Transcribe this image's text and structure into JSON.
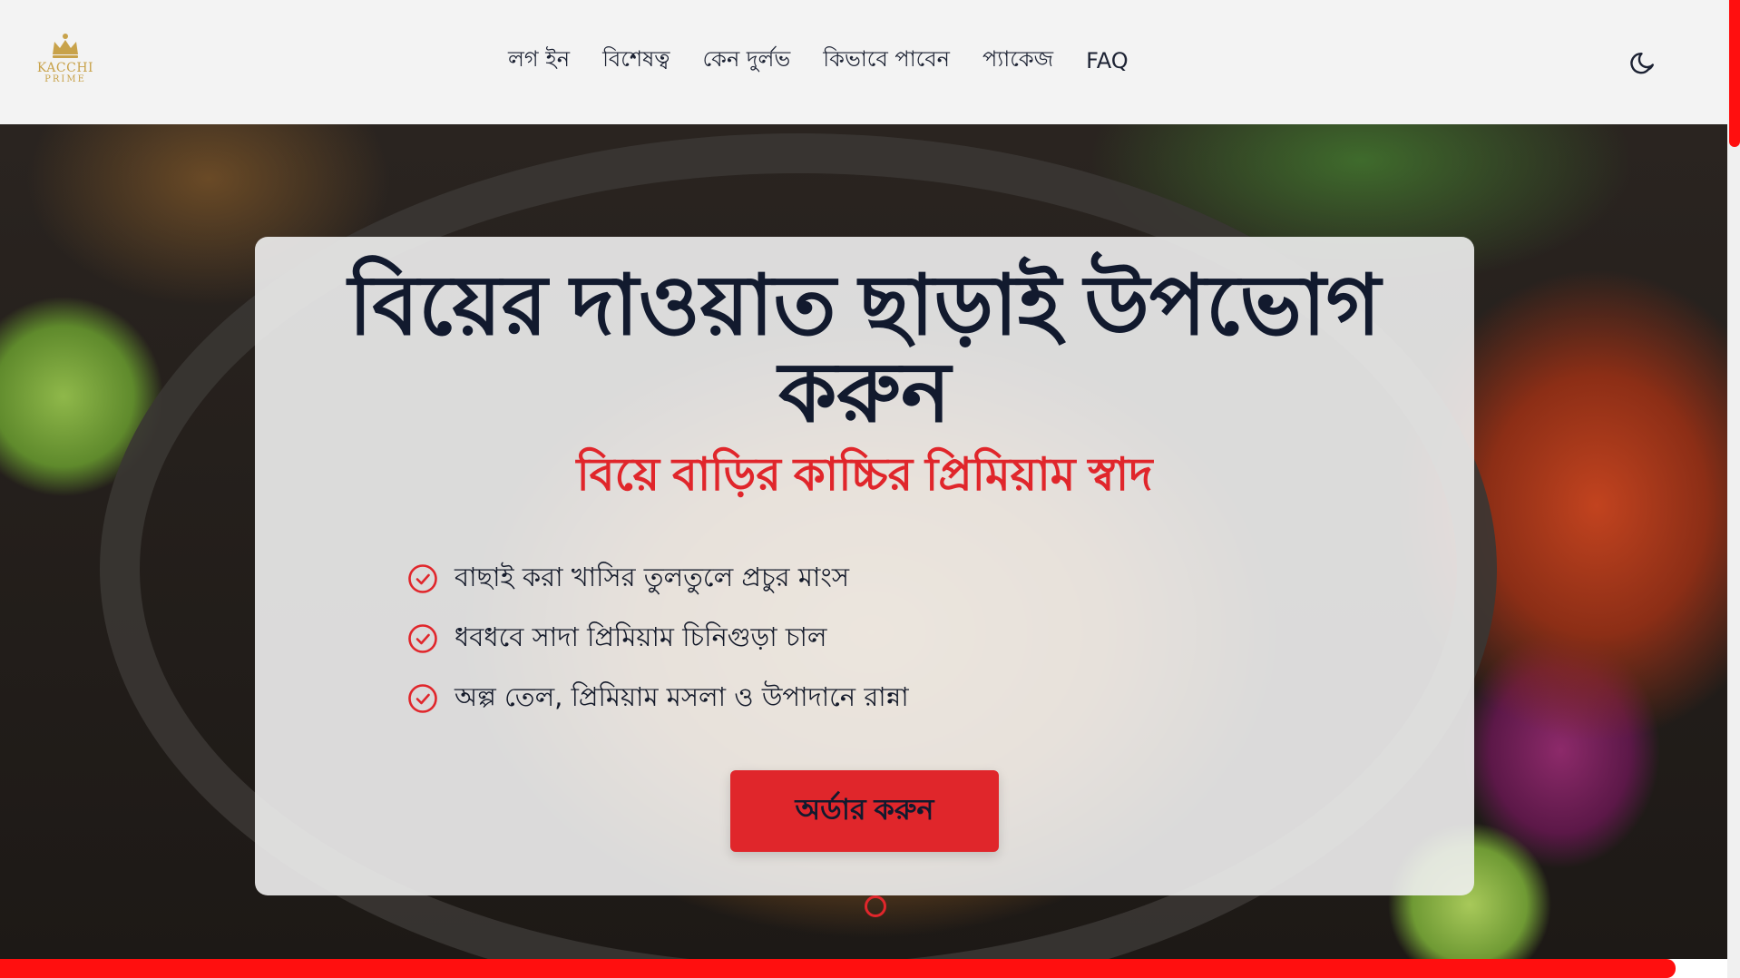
{
  "brand": {
    "logo_line1": "KACCHI",
    "logo_line2": "PRIME",
    "logo_icon": "crown-icon",
    "gold": "#c8a24a"
  },
  "nav": {
    "items": [
      {
        "label": "লগ ইন"
      },
      {
        "label": "বিশেষত্ব"
      },
      {
        "label": "কেন দুর্লভ"
      },
      {
        "label": "কিভাবে পাবেন"
      },
      {
        "label": "প্যাকেজ"
      },
      {
        "label": "FAQ"
      }
    ],
    "theme_toggle_icon": "moon-icon"
  },
  "hero": {
    "title": "বিয়ের দাওয়াত ছাড়াই উপভোগ করুন",
    "subtitle": "বিয়ে বাড়ির কাচ্চির প্রিমিয়াম স্বাদ",
    "features": [
      {
        "text": "বাছাই করা খাসির তুলতুলে প্রচুর মাংস",
        "icon": "check-circle-icon"
      },
      {
        "text": "ধবধবে সাদা প্রিমিয়াম চিনিগুড়া চাল",
        "icon": "check-circle-icon"
      },
      {
        "text": "অল্প তেল, প্রিমিয়াম মসলা ও উপাদানে রান্না",
        "icon": "check-circle-icon"
      }
    ],
    "cta_label": "অর্ডার করুন",
    "slide_count": 1,
    "active_slide": 1
  },
  "progress": {
    "scroll_fraction": 0.97
  },
  "colors": {
    "accent": "#e0262b",
    "progress": "#ff0f0f",
    "text_dark": "#121a2e",
    "header_bg": "#f3f3f3"
  }
}
